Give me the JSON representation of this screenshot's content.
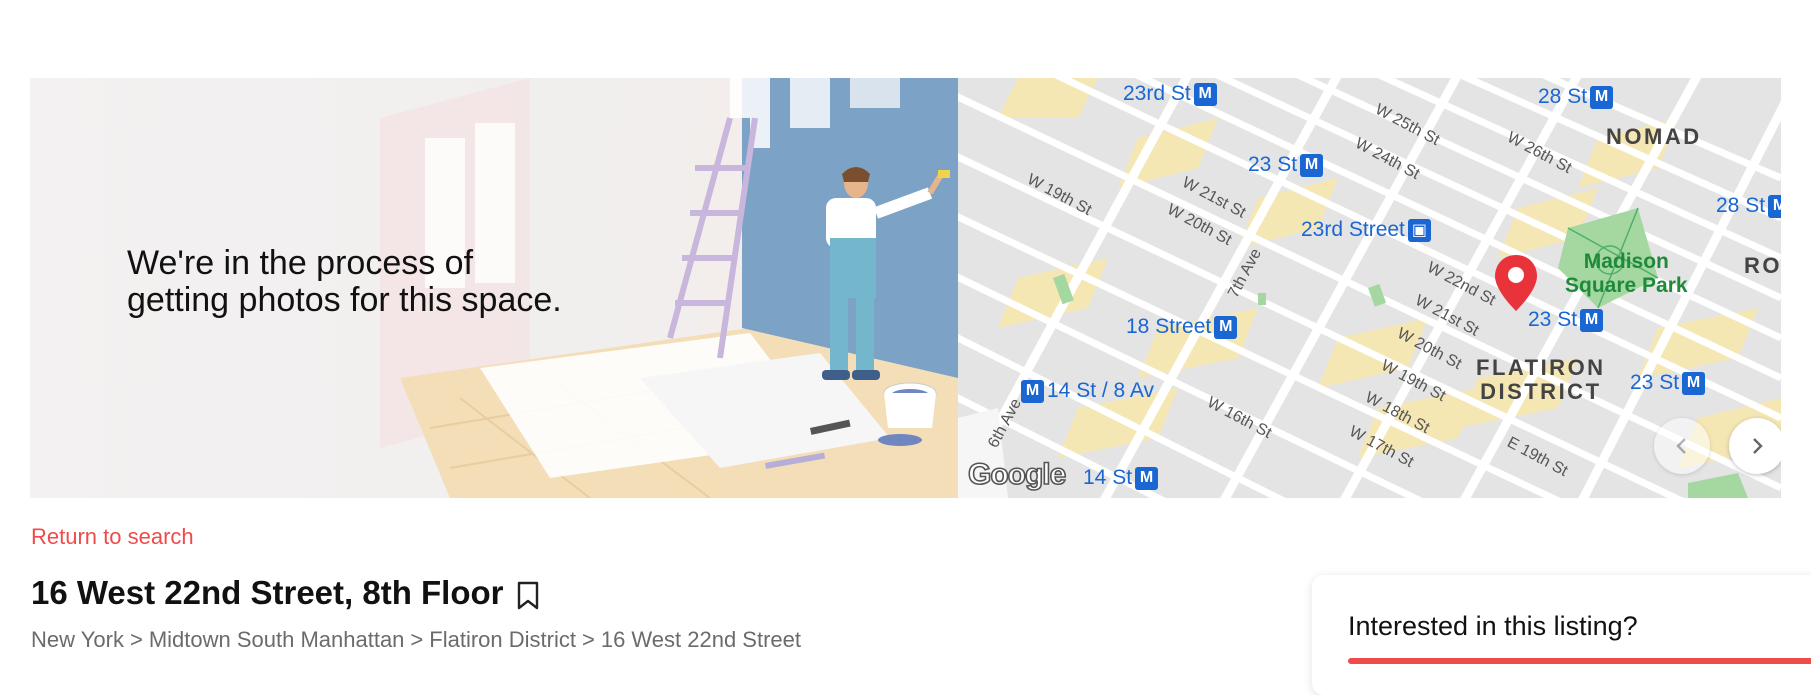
{
  "gallery": {
    "placeholder_text": "We're in the process of\ngetting photos for this space.",
    "prev_icon": "chevron-left-icon",
    "next_icon": "chevron-right-icon"
  },
  "map": {
    "provider_logo": "Google",
    "stations": [
      {
        "label": "23rd St",
        "badge": "M"
      },
      {
        "label": "23 St",
        "badge": "M"
      },
      {
        "label": "23rd Street",
        "badge": "bus"
      },
      {
        "label": "18 Street",
        "badge": "M"
      },
      {
        "label": "14 St / 8 Av",
        "badge": "M"
      },
      {
        "label": "14 St",
        "badge": "M"
      },
      {
        "label": "28 St",
        "badge": "M"
      },
      {
        "label": "28 St",
        "badge": "M"
      },
      {
        "label": "23 St",
        "badge": "M"
      },
      {
        "label": "23 St",
        "badge": "M"
      }
    ],
    "streets": [
      "W 25th St",
      "W 24th St",
      "W 26th St",
      "W 19th St",
      "W 21st St",
      "W 20th St",
      "7th Ave",
      "W 22nd St",
      "W 21st St",
      "W 20th St",
      "W 19th St",
      "W 18th St",
      "W 17th St",
      "W 16th St",
      "E 19th St",
      "6th Ave"
    ],
    "districts": [
      "NOMAD",
      "FLATIRON\nDISTRICT",
      "ROS"
    ],
    "park": "Madison\nSquare Park",
    "colors": {
      "water": "#a7c8ec",
      "block": "#f5e7b4",
      "transit": "#1a66d2",
      "park": "#a5d8a0",
      "pin": "#e8333a"
    }
  },
  "listing": {
    "return_link": "Return to search",
    "title": "16 West 22nd Street, 8th Floor",
    "bookmark_icon": "bookmark-icon",
    "breadcrumb": [
      "New York",
      "Midtown South Manhattan",
      "Flatiron District",
      "16 West 22nd Street"
    ],
    "breadcrumb_separator": ">",
    "accent_color": "#ef4b4b"
  },
  "sidebar": {
    "interest_title": "Interested in this listing?"
  }
}
